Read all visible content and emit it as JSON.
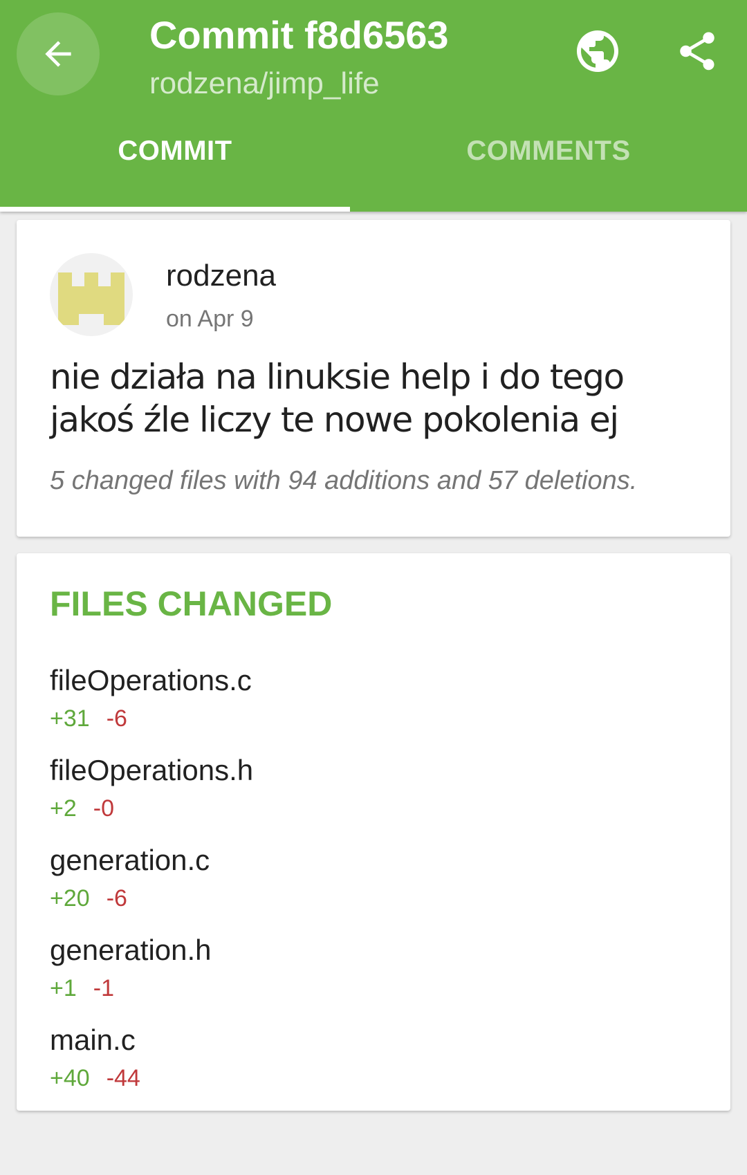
{
  "header": {
    "title": "Commit f8d6563",
    "subtitle": "rodzena/jimp_life",
    "back_icon": "arrow-left-icon",
    "globe_icon": "globe-icon",
    "share_icon": "share-icon"
  },
  "tabs": [
    {
      "label": "COMMIT",
      "selected": true
    },
    {
      "label": "COMMENTS",
      "selected": false
    }
  ],
  "commit": {
    "author": "rodzena",
    "date": "on Apr 9",
    "message": "nie działa na linuksie help i do tego jakoś źle liczy te nowe pokolenia ej",
    "summary": "5 changed files with 94 additions and 57 deletions."
  },
  "files": {
    "header": "FILES CHANGED",
    "items": [
      {
        "name": "fileOperations.c",
        "additions": "+31",
        "deletions": "-6"
      },
      {
        "name": "fileOperations.h",
        "additions": "+2",
        "deletions": "-0"
      },
      {
        "name": "generation.c",
        "additions": "+20",
        "deletions": "-6"
      },
      {
        "name": "generation.h",
        "additions": "+1",
        "deletions": "-1"
      },
      {
        "name": "main.c",
        "additions": "+40",
        "deletions": "-44"
      }
    ]
  },
  "colors": {
    "primary": "#69b545",
    "addition": "#5fa83b",
    "deletion": "#c0393b",
    "avatar": "#e0da80"
  }
}
